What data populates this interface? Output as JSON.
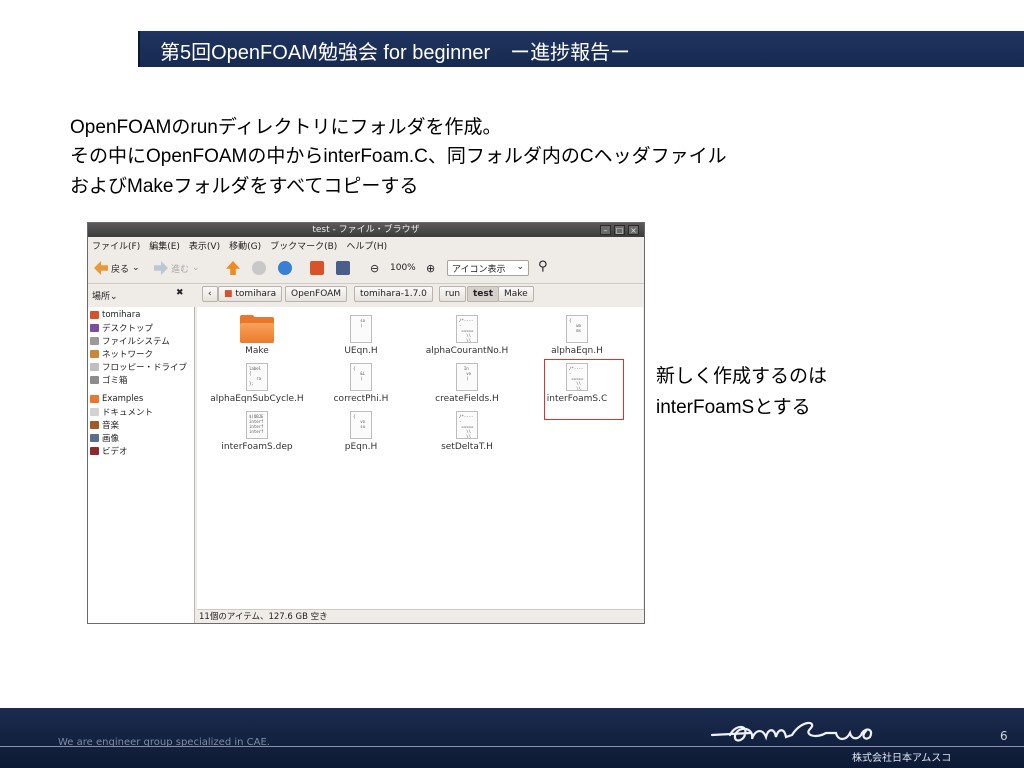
{
  "slide": {
    "title": "第5回OpenFOAM勉強会 for beginner　ー進捗報告ー",
    "lines": [
      "OpenFOAMのrunディレクトリにフォルダを作成。",
      "その中にOpenFOAMの中からinterFoam.C、同フォルダ内のCヘッダファイル",
      "およびMakeフォルダをすべてコピーする"
    ],
    "annotation": [
      "新しく作成するのは",
      "interFoamSとする"
    ],
    "footer_tagline": "We are engineer group specialized in CAE.",
    "company": "株式会社日本アムスコ",
    "page_number": "6"
  },
  "window": {
    "title": "test - ファイル・ブラウザ",
    "menus": [
      "ファイル(F)",
      "編集(E)",
      "表示(V)",
      "移動(G)",
      "ブックマーク(B)",
      "ヘルプ(H)"
    ],
    "toolbar": {
      "back": "戻る",
      "forward": "進む",
      "zoom": "100%",
      "view_mode": "アイコン表示"
    },
    "places_label": "場所",
    "breadcrumbs": [
      "tomihara",
      "OpenFOAM",
      "tomihara-1.7.0",
      "run",
      "test",
      "Make"
    ],
    "sidebar": [
      "tomihara",
      "デスクトップ",
      "ファイルシステム",
      "ネットワーク",
      "フロッピー・ドライブ",
      "ゴミ箱",
      "Examples",
      "ドキュメント",
      "音楽",
      "画像",
      "ビデオ"
    ],
    "files": [
      "Make",
      "UEqn.H",
      "alphaCourantNo.H",
      "alphaEqn.H",
      "alphaEqnSubCycle.H",
      "correctPhi.H",
      "createFields.H",
      "interFoamS.C",
      "interFoamS.dep",
      "pEqn.H",
      "setDeltaT.H"
    ],
    "status": "11個のアイテム、127.6 GB 空き"
  }
}
